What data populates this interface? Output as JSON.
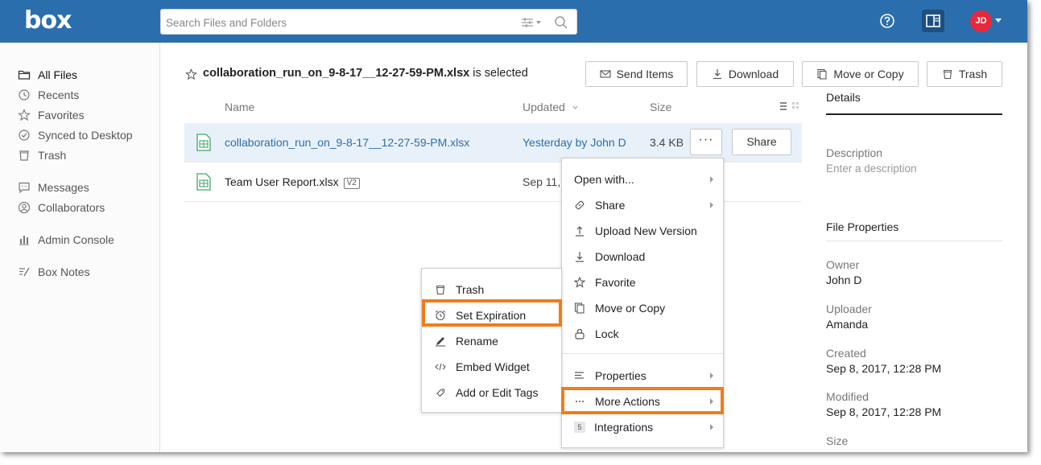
{
  "header": {
    "logo": "box",
    "search_placeholder": "Search Files and Folders",
    "avatar_initials": "JD",
    "accent": "#2b6ead"
  },
  "sidebar": {
    "items": [
      {
        "label": "All Files",
        "icon": "folder-icon"
      },
      {
        "label": "Recents",
        "icon": "clock-icon"
      },
      {
        "label": "Favorites",
        "icon": "star-icon"
      },
      {
        "label": "Synced to Desktop",
        "icon": "sync-check-icon"
      },
      {
        "label": "Trash",
        "icon": "trash-icon"
      },
      {
        "label": "Messages",
        "icon": "message-icon"
      },
      {
        "label": "Collaborators",
        "icon": "user-circle-icon"
      },
      {
        "label": "Admin Console",
        "icon": "bar-chart-icon"
      },
      {
        "label": "Box Notes",
        "icon": "notes-icon"
      }
    ]
  },
  "selection": {
    "filename": "collaboration_run_on_9-8-17__12-27-59-PM.xlsx",
    "suffix": "is selected"
  },
  "toolbar": {
    "send_items": "Send Items",
    "download": "Download",
    "move_or_copy": "Move or Copy",
    "trash": "Trash"
  },
  "columns": {
    "name": "Name",
    "updated": "Updated",
    "size": "Size"
  },
  "files": [
    {
      "name": "collaboration_run_on_9-8-17__12-27-59-PM.xlsx",
      "updated": "Yesterday by John D",
      "size": "3.4 KB",
      "more": "···",
      "share": "Share"
    },
    {
      "name": "Team User Report.xlsx",
      "version": "V2",
      "updated": "Sep 11, 2"
    }
  ],
  "details": {
    "tab": "Details",
    "description_label": "Description",
    "description_placeholder": "Enter a description",
    "file_properties": "File Properties",
    "owner_label": "Owner",
    "owner": "John D",
    "uploader_label": "Uploader",
    "uploader": "Amanda",
    "created_label": "Created",
    "created": "Sep 8, 2017, 12:28 PM",
    "modified_label": "Modified",
    "modified": "Sep 8, 2017, 12:28 PM",
    "size_label": "Size"
  },
  "context_menu": {
    "items": [
      {
        "label": "Open with...",
        "icon": "none",
        "submenu": true
      },
      {
        "label": "Share",
        "icon": "link-icon",
        "submenu": true
      },
      {
        "label": "Upload New Version",
        "icon": "upload-icon"
      },
      {
        "label": "Download",
        "icon": "download-icon"
      },
      {
        "label": "Favorite",
        "icon": "star-icon"
      },
      {
        "label": "Move or Copy",
        "icon": "copy-icon"
      },
      {
        "label": "Lock",
        "icon": "lock-icon"
      },
      {
        "label": "Properties",
        "icon": "properties-icon",
        "submenu": true
      },
      {
        "label": "More Actions",
        "icon": "ellipsis-icon",
        "submenu": true,
        "highlighted": true
      },
      {
        "label": "Integrations",
        "badge": "5",
        "submenu": true
      }
    ]
  },
  "more_actions_menu": {
    "items": [
      {
        "label": "Trash",
        "icon": "trash-icon"
      },
      {
        "label": "Set Expiration",
        "icon": "alarm-clock-icon",
        "highlighted": true
      },
      {
        "label": "Rename",
        "icon": "pencil-icon"
      },
      {
        "label": "Embed Widget",
        "icon": "code-icon"
      },
      {
        "label": "Add or Edit Tags",
        "icon": "tag-icon"
      }
    ]
  },
  "highlight_color": "#ef7d1a"
}
